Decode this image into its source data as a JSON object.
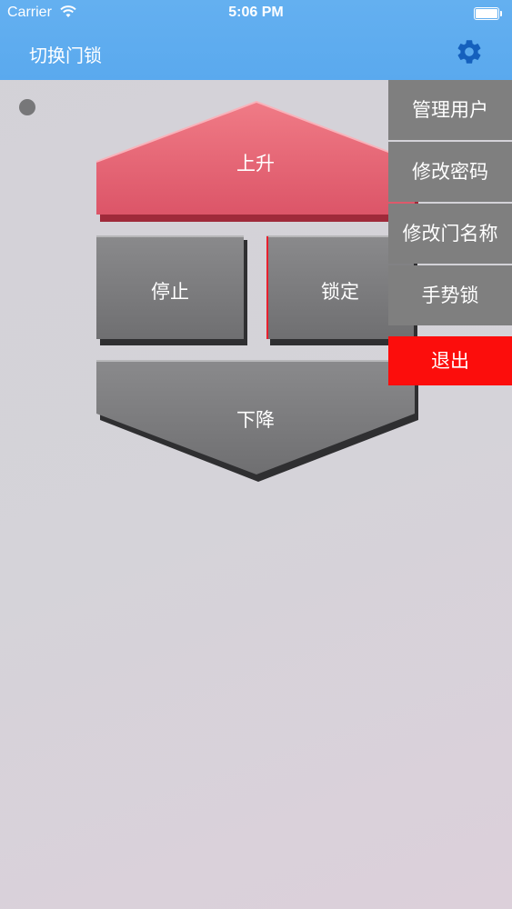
{
  "status_bar": {
    "carrier": "Carrier",
    "time": "5:06 PM"
  },
  "nav": {
    "title": "切换门锁",
    "settings_icon": "gear-icon"
  },
  "controls": {
    "up_label": "上升",
    "stop_label": "停止",
    "lock_label": "锁定",
    "down_label": "下降"
  },
  "menu": {
    "items": [
      {
        "label": "管理用户"
      },
      {
        "label": "修改密码"
      },
      {
        "label": "修改门名称"
      },
      {
        "label": "手势锁"
      }
    ],
    "exit_label": "退出"
  },
  "colors": {
    "nav_bg": "#5aa9ee",
    "up_button": "#e8606e",
    "menu_bg": "#7f7f7f",
    "exit_bg": "#fc0d0c"
  }
}
